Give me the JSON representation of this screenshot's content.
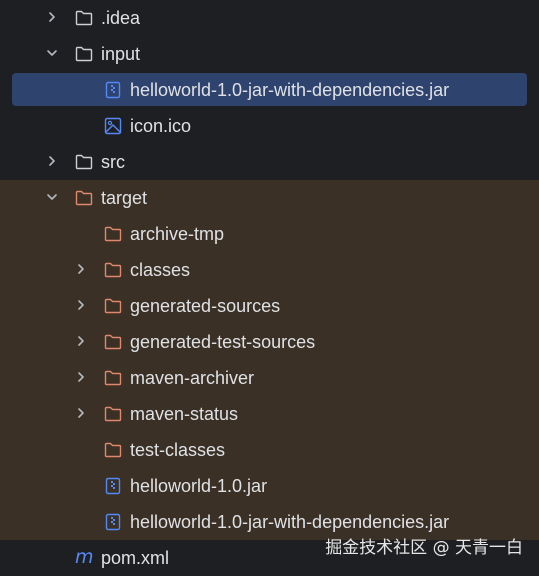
{
  "tree": {
    "items": [
      {
        "label": ".idea"
      },
      {
        "label": "input"
      },
      {
        "label": "helloworld-1.0-jar-with-dependencies.jar"
      },
      {
        "label": "icon.ico"
      },
      {
        "label": "src"
      },
      {
        "label": "target"
      },
      {
        "label": "archive-tmp"
      },
      {
        "label": "classes"
      },
      {
        "label": "generated-sources"
      },
      {
        "label": "generated-test-sources"
      },
      {
        "label": "maven-archiver"
      },
      {
        "label": "maven-status"
      },
      {
        "label": "test-classes"
      },
      {
        "label": "helloworld-1.0.jar"
      },
      {
        "label": "helloworld-1.0-jar-with-dependencies.jar"
      },
      {
        "label": "pom.xml"
      }
    ]
  },
  "watermark": "掘金技术社区 @ 天青一白",
  "colors": {
    "background": "#1e1f22",
    "excluded_row": "#3a3025",
    "selection": "#2e436e",
    "folder_normal": "#ced0d6",
    "folder_excluded": "#e0886c",
    "file_icon": "#548af7",
    "text": "#dfe1e5"
  },
  "icons": {
    "chevron_right": "chevron-right-icon",
    "chevron_down": "chevron-down-icon",
    "folder": "folder-icon",
    "jar": "jar-file-icon",
    "image": "image-file-icon",
    "maven": "maven-icon"
  }
}
